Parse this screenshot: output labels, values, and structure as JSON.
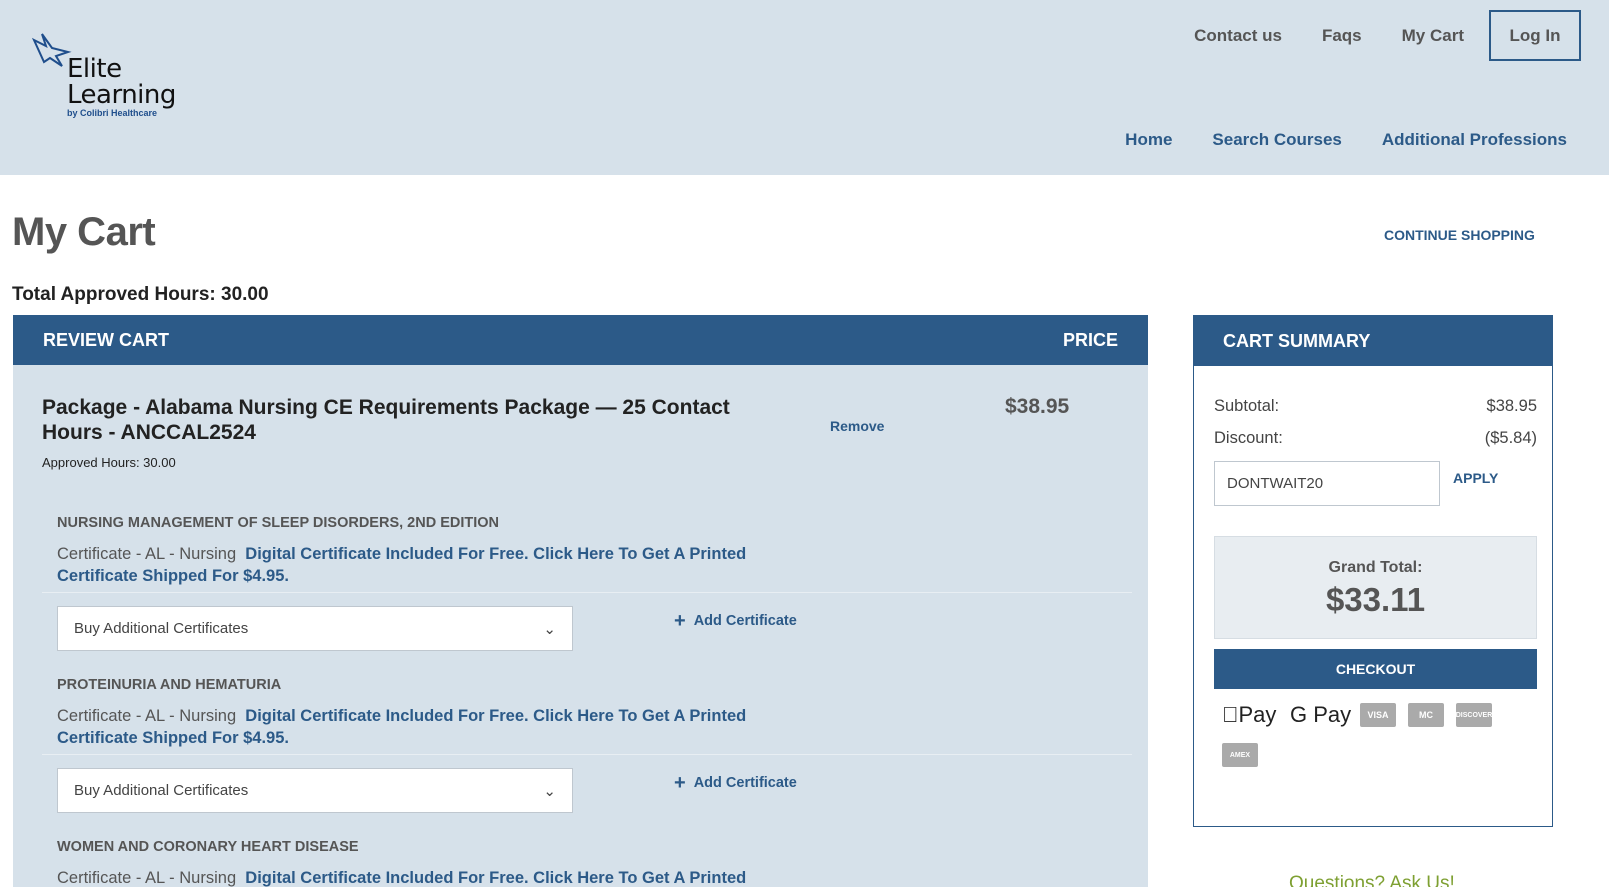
{
  "header": {
    "logo": {
      "line1": "Elite",
      "line2": "Learning",
      "line3": "by Colibri Healthcare"
    },
    "top_nav": [
      "Contact us",
      "Faqs",
      "My Cart"
    ],
    "login": "Log In",
    "main_nav": [
      "Home",
      "Search Courses",
      "Additional Professions"
    ]
  },
  "page": {
    "title": "My Cart",
    "continue_shopping": "CONTINUE SHOPPING",
    "total_hours": "Total Approved Hours: 30.00"
  },
  "review": {
    "header_left": "REVIEW CART",
    "header_right": "PRICE",
    "package": {
      "title": "Package - Alabama Nursing CE Requirements Package — 25 Contact Hours - ANCCAL2524",
      "hours": "Approved Hours: 30.00",
      "remove": "Remove",
      "price": "$38.95"
    },
    "courses": [
      {
        "title": "NURSING MANAGEMENT OF SLEEP DISORDERS, 2ND EDITION",
        "cert_label": "Certificate - AL - Nursing",
        "cert_link": "Digital Certificate Included For Free. Click Here To Get A Printed Certificate Shipped For $4.95.",
        "select": "Buy Additional Certificates",
        "add": "Add Certificate"
      },
      {
        "title": "PROTEINURIA AND HEMATURIA",
        "cert_label": "Certificate - AL - Nursing",
        "cert_link": "Digital Certificate Included For Free. Click Here To Get A Printed Certificate Shipped For $4.95.",
        "select": "Buy Additional Certificates",
        "add": "Add Certificate"
      },
      {
        "title": "WOMEN AND CORONARY HEART DISEASE",
        "cert_label": "Certificate - AL - Nursing",
        "cert_link": "Digital Certificate Included For Free. Click Here To Get A Printed"
      }
    ]
  },
  "summary": {
    "header": "CART SUMMARY",
    "subtotal_label": "Subtotal:",
    "subtotal_value": "$38.95",
    "discount_label": "Discount:",
    "discount_value": "($5.84)",
    "discount_code": "DONTWAIT20",
    "apply": "APPLY",
    "grand_label": "Grand Total:",
    "grand_value": "$33.11",
    "checkout": "CHECKOUT",
    "payments": {
      "apple": "Pay",
      "google": "G Pay",
      "visa": "VISA",
      "mastercard": "MC",
      "discover": "DISCOVER",
      "amex": "AMEX"
    }
  },
  "questions": "Questions? Ask Us!"
}
